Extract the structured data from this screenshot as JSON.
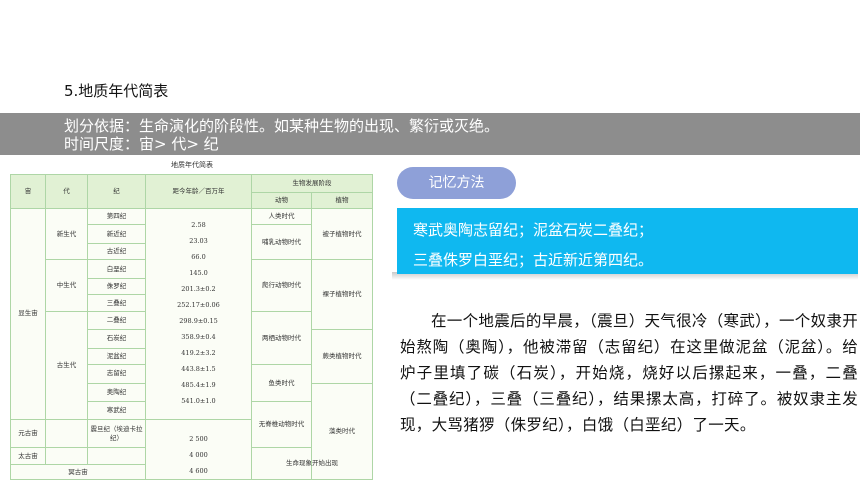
{
  "title": "5.地质年代简表",
  "band": {
    "line1": "划分依据：生命演化的阶段性。如某种生物的出现、繁衍或灭绝。",
    "line2": "时间尺度：宙> 代> 纪"
  },
  "geo_table": {
    "caption": "地质年代简表",
    "headers": {
      "eon": "宙",
      "era": "代",
      "period": "纪",
      "age": "距今年龄／百万年",
      "bio": "生物发展阶段",
      "animal": "动物",
      "plant": "植物"
    },
    "eons": {
      "phanerozoic": "显生宙",
      "proterozoic": "元古宙",
      "archean": "太古宙",
      "hadean": "冥古宙"
    },
    "eras": {
      "cenozoic": "新生代",
      "mesozoic": "中生代",
      "paleozoic": "古生代"
    },
    "periods": [
      "第四纪",
      "新近纪",
      "古近纪",
      "白垩纪",
      "侏罗纪",
      "三叠纪",
      "二叠纪",
      "石炭纪",
      "泥盆纪",
      "志留纪",
      "奥陶纪",
      "寒武纪"
    ],
    "sinian": "震旦纪（埃迪卡拉纪）",
    "ages": [
      "2.58",
      "23.03",
      "66.0",
      "145.0",
      "201.3±0.2",
      "252.17±0.06",
      "298.9±0.15",
      "358.9±0.4",
      "419.2±3.2",
      "443.8±1.5",
      "485.4±1.9",
      "541.0±1.0"
    ],
    "ages_lower": [
      "2 500",
      "4 000",
      "4 600"
    ],
    "animals": [
      "人类时代",
      "哺乳动物时代",
      "爬行动物时代",
      "两栖动物时代",
      "鱼类时代",
      "无脊椎动物时代"
    ],
    "plants": [
      "被子植物时代",
      "裸子植物时代",
      "蕨类植物时代",
      "藻类时代"
    ],
    "life_origin": "生命现象开始出现"
  },
  "memory": {
    "pill": "记忆方法",
    "line1": "寒武奥陶志留纪；泥盆石炭二叠纪；",
    "line2": "三叠侏罗白垩纪；古近新近第四纪。"
  },
  "story": "在一个地震后的早晨，（震旦）天气很冷（寒武），一个奴隶开始熬陶（奥陶），他被滞留（志留纪）在这里做泥盆（泥盆）。给炉子里填了碳（石炭），开始烧，烧好以后摞起来，一叠，二叠（二叠纪），三叠（三叠纪），结果摞太高，打碎了。被奴隶主发现，大骂猪猡（侏罗纪），白饿（白垩纪）了一天。",
  "colors": {
    "band": "#8d8d8d",
    "pill": "#8ea0d8",
    "cyan": "#0fb8f0",
    "table_border": "#aed6a6",
    "table_header": "#e1f1d4"
  }
}
